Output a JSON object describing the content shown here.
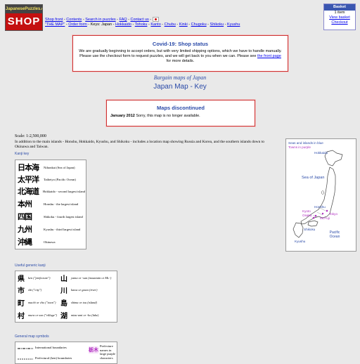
{
  "logo": {
    "top_text": "JapanesePuzzles.com",
    "shop_text": "SHOP"
  },
  "nav": {
    "links": [
      "Shop front",
      "Contents",
      "Search in puzzles",
      "FAQ",
      "Contact us"
    ],
    "links2": [
      "\"THE MAP\"",
      "Order form"
    ],
    "keys_label": "Keys:",
    "keys": [
      "Japan",
      "Hokkaido",
      "Tohoku",
      "Kanto",
      "Chubu",
      "Kinki",
      "Chugoku",
      "Shikoku",
      "Kyushu"
    ]
  },
  "basket": {
    "title": "Basket",
    "count": "1 item",
    "view": "View basket",
    "checkout": "Checkout"
  },
  "covid": {
    "title": "Covid-19: Shop status",
    "text": "We are gradually beginning to accept orders, but with very limited shipping options, which we have to handle manually. Please use the checkout form to request puzzles, and we will get back to you when we can. Please see",
    "link": "the front page",
    "text_end": "for more details."
  },
  "subtitle": "Bargain maps of Japan",
  "title": "Japan Map - Key",
  "discontinued": {
    "title": "Maps discontinued",
    "date": "January 2012",
    "text": "Sorry, this map is no longer available."
  },
  "scale": "Scale: 1:2,500,000",
  "intro": "In addition to the main islands - Honshu, Hokkaido, Kyushu, and Shikoku - includes a location map showing Russia and Korea, and the southern islands down to Okinawa and Taiwan.",
  "kanji_key": {
    "heading": "Kanji key",
    "rows": [
      {
        "k": "日本海",
        "d": "Nihonkai (Sea of Japan)"
      },
      {
        "k": "太平洋",
        "d": "Taiheiyo (Pacific Ocean)"
      },
      {
        "k": "北海道",
        "d": "Hokkaido - second largest island"
      },
      {
        "k": "本州",
        "d": "Honshu - the largest island"
      },
      {
        "k": "四国",
        "d": "Shikoku - fourth largest island"
      },
      {
        "k": "九州",
        "d": "Kyushu - third largest island"
      },
      {
        "k": "沖縄",
        "d": "Okinawa"
      }
    ]
  },
  "generic_kanji": {
    "heading": "Useful generic kanji",
    "left": [
      {
        "k": "県",
        "d": "ken (\"prefecture\")"
      },
      {
        "k": "市",
        "d": "shi (\"city\")"
      },
      {
        "k": "町",
        "d": "machi or cho (\"town\")"
      },
      {
        "k": "村",
        "d": "mura or son (\"village\")"
      }
    ],
    "right": [
      {
        "k": "山",
        "d": "yama or -san (mountain or Mt.-)"
      },
      {
        "k": "川",
        "d": "kawa or gawa (river)"
      },
      {
        "k": "島",
        "d": "shima or tou (island)"
      },
      {
        "k": "湖",
        "d": "mizu-umi or -ko (lake)"
      }
    ]
  },
  "symbols": {
    "heading": "General map symbols",
    "items": [
      "International boundaries",
      "Prefectural (ken) boundaries"
    ],
    "pref_kanji": "栃木",
    "pref_text": "Prefecture names in large purple characters"
  },
  "map": {
    "legend1": "Seas and islands in blue",
    "legend2": "Towns in purple",
    "labels": {
      "hokkaido": "Hokkaido",
      "sea": "Sea of Japan",
      "honshu": "Honshu",
      "tokyo": "Tokyo",
      "kyoto": "Kyoto",
      "osaka": "Osaka",
      "mtfuji": "Mt.Fuji",
      "kyushu": "Kyushu",
      "shikoku": "Shikoku",
      "pacific": "Pacific Ocean"
    },
    "colors": {
      "sea": "#2a4aa8",
      "town": "#b030c0",
      "land": "#ffffff"
    }
  }
}
